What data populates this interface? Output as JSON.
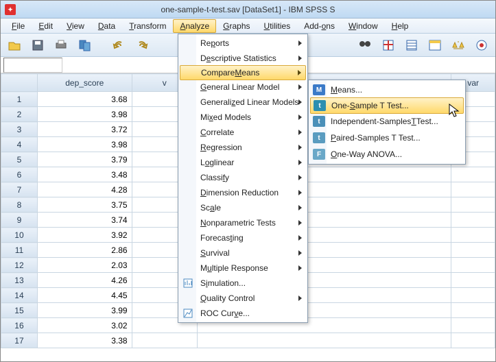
{
  "title": "one-sample-t-test.sav [DataSet1] - IBM SPSS S",
  "menubar": [
    {
      "label": "File",
      "u": "F",
      "rest": "ile"
    },
    {
      "label": "Edit",
      "u": "E",
      "rest": "dit"
    },
    {
      "label": "View",
      "u": "V",
      "rest": "iew"
    },
    {
      "label": "Data",
      "u": "D",
      "rest": "ata"
    },
    {
      "label": "Transform",
      "u": "T",
      "rest": "ransform"
    },
    {
      "label": "Analyze",
      "u": "A",
      "rest": "nalyze",
      "open": true
    },
    {
      "label": "Graphs",
      "u": "G",
      "rest": "raphs"
    },
    {
      "label": "Utilities",
      "u": "U",
      "rest": "tilities"
    },
    {
      "label": "Add-ons",
      "u": "",
      "rest": "Add-ons",
      "uNone": true,
      "uText": "o"
    },
    {
      "label": "Window",
      "u": "W",
      "rest": "indow"
    },
    {
      "label": "Help",
      "u": "H",
      "rest": "elp"
    }
  ],
  "column_header": "dep_score",
  "var_label": "var",
  "rows": [
    {
      "n": 1,
      "v": "3.68"
    },
    {
      "n": 2,
      "v": "3.98"
    },
    {
      "n": 3,
      "v": "3.72"
    },
    {
      "n": 4,
      "v": "3.98"
    },
    {
      "n": 5,
      "v": "3.79"
    },
    {
      "n": 6,
      "v": "3.48"
    },
    {
      "n": 7,
      "v": "4.28"
    },
    {
      "n": 8,
      "v": "3.75"
    },
    {
      "n": 9,
      "v": "3.74"
    },
    {
      "n": 10,
      "v": "3.92"
    },
    {
      "n": 11,
      "v": "2.86"
    },
    {
      "n": 12,
      "v": "2.03"
    },
    {
      "n": 13,
      "v": "4.26"
    },
    {
      "n": 14,
      "v": "4.45"
    },
    {
      "n": 15,
      "v": "3.99"
    },
    {
      "n": 16,
      "v": "3.02"
    },
    {
      "n": 17,
      "v": "3.38"
    }
  ],
  "analyze_menu": [
    {
      "label": "Reports",
      "u": "",
      "sub": true,
      "pre": "Re",
      "uc": "p",
      "post": "orts"
    },
    {
      "label": "Descriptive Statistics",
      "u": "E",
      "sub": true,
      "pre": "D",
      "uc": "e",
      "post": "scriptive Statistics"
    },
    {
      "label": "Compare Means",
      "u": "M",
      "sub": true,
      "hl": true,
      "pre": "Compare ",
      "uc": "M",
      "post": "eans"
    },
    {
      "label": "General Linear Model",
      "u": "G",
      "sub": true,
      "pre": "",
      "uc": "G",
      "post": "eneral Linear Model"
    },
    {
      "label": "Generalized Linear Models",
      "u": "Z",
      "sub": true,
      "pre": "Generali",
      "uc": "z",
      "post": "ed Linear Models"
    },
    {
      "label": "Mixed Models",
      "u": "x",
      "sub": true,
      "pre": "Mi",
      "uc": "x",
      "post": "ed Models"
    },
    {
      "label": "Correlate",
      "u": "C",
      "sub": true,
      "pre": "",
      "uc": "C",
      "post": "orrelate"
    },
    {
      "label": "Regression",
      "u": "R",
      "sub": true,
      "pre": "",
      "uc": "R",
      "post": "egression"
    },
    {
      "label": "Loglinear",
      "u": "o",
      "sub": true,
      "pre": "L",
      "uc": "o",
      "post": "glinear"
    },
    {
      "label": "Classify",
      "u": "F",
      "sub": true,
      "pre": "Classi",
      "uc": "f",
      "post": "y"
    },
    {
      "label": "Dimension Reduction",
      "u": "D",
      "sub": true,
      "pre": "",
      "uc": "D",
      "post": "imension Reduction"
    },
    {
      "label": "Scale",
      "u": "A",
      "sub": true,
      "pre": "Sc",
      "uc": "a",
      "post": "le"
    },
    {
      "label": "Nonparametric Tests",
      "u": "N",
      "sub": true,
      "pre": "",
      "uc": "N",
      "post": "onparametric Tests"
    },
    {
      "label": "Forecasting",
      "u": "T",
      "sub": true,
      "pre": "Forecas",
      "uc": "t",
      "post": "ing"
    },
    {
      "label": "Survival",
      "u": "S",
      "sub": true,
      "pre": "",
      "uc": "S",
      "post": "urvival"
    },
    {
      "label": "Multiple Response",
      "u": "u",
      "sub": true,
      "pre": "M",
      "uc": "u",
      "post": "ltiple Response"
    },
    {
      "label": "Simulation...",
      "u": "",
      "sub": false,
      "icon": "sim",
      "pre": "S",
      "uc": "i",
      "post": "mulation..."
    },
    {
      "label": "Quality Control",
      "u": "Q",
      "sub": true,
      "pre": "",
      "uc": "Q",
      "post": "uality Control"
    },
    {
      "label": "ROC Curve...",
      "u": "",
      "sub": false,
      "icon": "roc",
      "pre": "ROC Cur",
      "uc": "v",
      "post": "e..."
    }
  ],
  "compare_means_sub": [
    {
      "label": "Means...",
      "u": "M",
      "icon_bg": "#3a7ac8",
      "icon_txt": "M",
      "pre": "",
      "uc": "M",
      "post": "eans..."
    },
    {
      "label": "One-Sample T Test...",
      "u": "S",
      "hl": true,
      "icon_bg": "#2d8fb0",
      "icon_txt": "t",
      "pre": "One-",
      "uc": "S",
      "post": "ample T Test..."
    },
    {
      "label": "Independent-Samples T Test...",
      "u": "",
      "icon_bg": "#4a8fb8",
      "icon_txt": "t",
      "pre": "Independent-Samples ",
      "uc": "T",
      "post": " Test..."
    },
    {
      "label": "Paired-Samples T Test...",
      "u": "P",
      "icon_bg": "#5a9cc0",
      "icon_txt": "t",
      "pre": "",
      "uc": "P",
      "post": "aired-Samples T Test..."
    },
    {
      "label": "One-Way ANOVA...",
      "u": "O",
      "icon_bg": "#6aa8c8",
      "icon_txt": "F",
      "pre": "",
      "uc": "O",
      "post": "ne-Way ANOVA..."
    }
  ],
  "toolbar_icons": [
    "open",
    "save",
    "print",
    "recall",
    "undo",
    "redo",
    "goto",
    "vars",
    "find",
    "insert-case",
    "insert-var",
    "split",
    "weight",
    "select",
    "value-labels"
  ]
}
